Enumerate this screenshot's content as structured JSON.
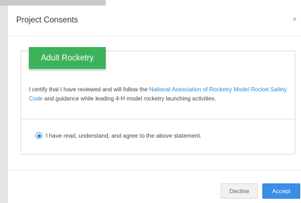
{
  "modal": {
    "title": "Project Consents",
    "close_label": "×"
  },
  "consent": {
    "tab_label": "Adult Rocketry",
    "text_before": "I certify that I have reviewed and will follow the ",
    "link_text": "National Association of Rocketry Model Rocket Safety Code",
    "text_after": " and guidance while leading 4-H model rocketry launching activities.",
    "agree_label": "I have read, understand, and agree to the above statement.",
    "agree_selected": true
  },
  "footer": {
    "decline_label": "Decline",
    "accept_label": "Accept"
  },
  "colors": {
    "tab_green": "#3cb25a",
    "link_blue": "#2a8bd4",
    "accept_blue": "#3a8ee6"
  }
}
